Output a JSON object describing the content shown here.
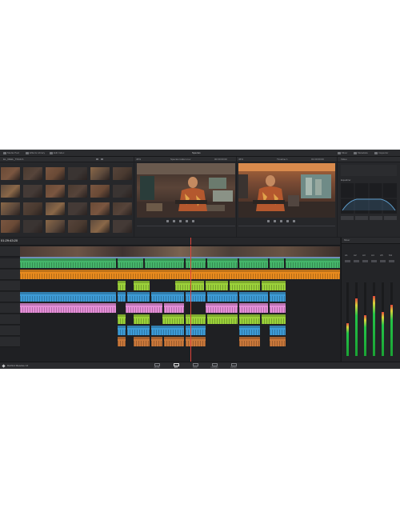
{
  "app": {
    "name": "DaVinci Resolve 14",
    "project_title": "Species"
  },
  "topbar": {
    "left_buttons": [
      "Media Pool",
      "Effects Library",
      "Edit Index"
    ],
    "right_buttons": [
      "Mixer",
      "Metadata",
      "Inspector"
    ]
  },
  "media_pool": {
    "bin": "EL_REEL_TRAILS",
    "thumbnail_count": 24
  },
  "source_viewer": {
    "zoom": "46%",
    "clip_name": "Species trailer.mov",
    "timecode": "00:00:00:00"
  },
  "timeline_viewer": {
    "zoom": "46%",
    "timeline_name": "Timeline 1",
    "timecode": "01:00:00:00"
  },
  "timeline": {
    "current_timecode": "01:29:43:20"
  },
  "inspector": {
    "section_video": "Video",
    "section_eq": "Equalizer"
  },
  "mixer": {
    "title": "Mixer",
    "channels": [
      {
        "name": "A1",
        "level": 0.45
      },
      {
        "name": "A2",
        "level": 0.78
      },
      {
        "name": "A3",
        "level": 0.55
      },
      {
        "name": "A4",
        "level": 0.82
      },
      {
        "name": "A5",
        "level": 0.6
      },
      {
        "name": "M1",
        "level": 0.7
      }
    ]
  },
  "pages": [
    {
      "label": "Media",
      "active": false
    },
    {
      "label": "Edit",
      "active": true
    },
    {
      "label": "Color",
      "active": false
    },
    {
      "label": "Fairlight",
      "active": false
    },
    {
      "label": "Deliver",
      "active": false
    }
  ],
  "colors": {
    "clip_blue_video": "#6f8fb8",
    "audio_green": "#45b56a",
    "audio_orange": "#e88a1e",
    "audio_lime": "#9bd13a",
    "audio_blue": "#3d9bd6",
    "audio_pink": "#e58ed8",
    "audio_copper": "#c8773a",
    "playhead": "#e0433a"
  }
}
